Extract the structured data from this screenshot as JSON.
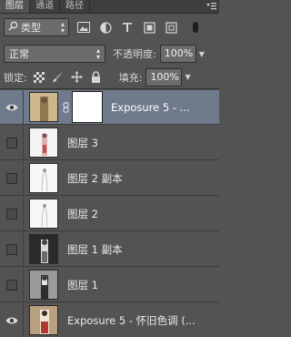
{
  "tabs": [
    {
      "label": "图层",
      "active": true
    },
    {
      "label": "通道",
      "active": false
    },
    {
      "label": "路径",
      "active": false
    }
  ],
  "panel_menu_icon": "panel-menu-icon",
  "filter": {
    "kind_label": "类型",
    "icons": [
      "image-filter-icon",
      "adjustment-filter-icon",
      "type-filter-icon",
      "shape-filter-icon",
      "smart-object-filter-icon"
    ]
  },
  "blend": {
    "mode": "正常",
    "opacity_label": "不透明度:",
    "opacity_value": "100%"
  },
  "lock": {
    "label": "锁定:",
    "icons": [
      "lock-transparent-icon",
      "lock-image-icon",
      "lock-position-icon",
      "lock-all-icon"
    ],
    "fill_label": "填充:",
    "fill_value": "100%"
  },
  "layers": [
    {
      "name": "Exposure 5 - ...",
      "visible": true,
      "selected": true,
      "has_mask": true,
      "thumb": "sepia"
    },
    {
      "name": "图层 3",
      "visible": false,
      "selected": false,
      "has_mask": false,
      "thumb": "white-red"
    },
    {
      "name": "图层 2 副本",
      "visible": false,
      "selected": false,
      "has_mask": false,
      "thumb": "white-sketch"
    },
    {
      "name": "图层 2",
      "visible": false,
      "selected": false,
      "has_mask": false,
      "thumb": "white-sketch"
    },
    {
      "name": "图层 1 副本",
      "visible": false,
      "selected": false,
      "has_mask": false,
      "thumb": "dark"
    },
    {
      "name": "图层 1",
      "visible": false,
      "selected": false,
      "has_mask": false,
      "thumb": "gray"
    },
    {
      "name": "Exposure 5 - 怀旧色调 (...",
      "visible": true,
      "selected": false,
      "has_mask": false,
      "thumb": "color"
    }
  ]
}
